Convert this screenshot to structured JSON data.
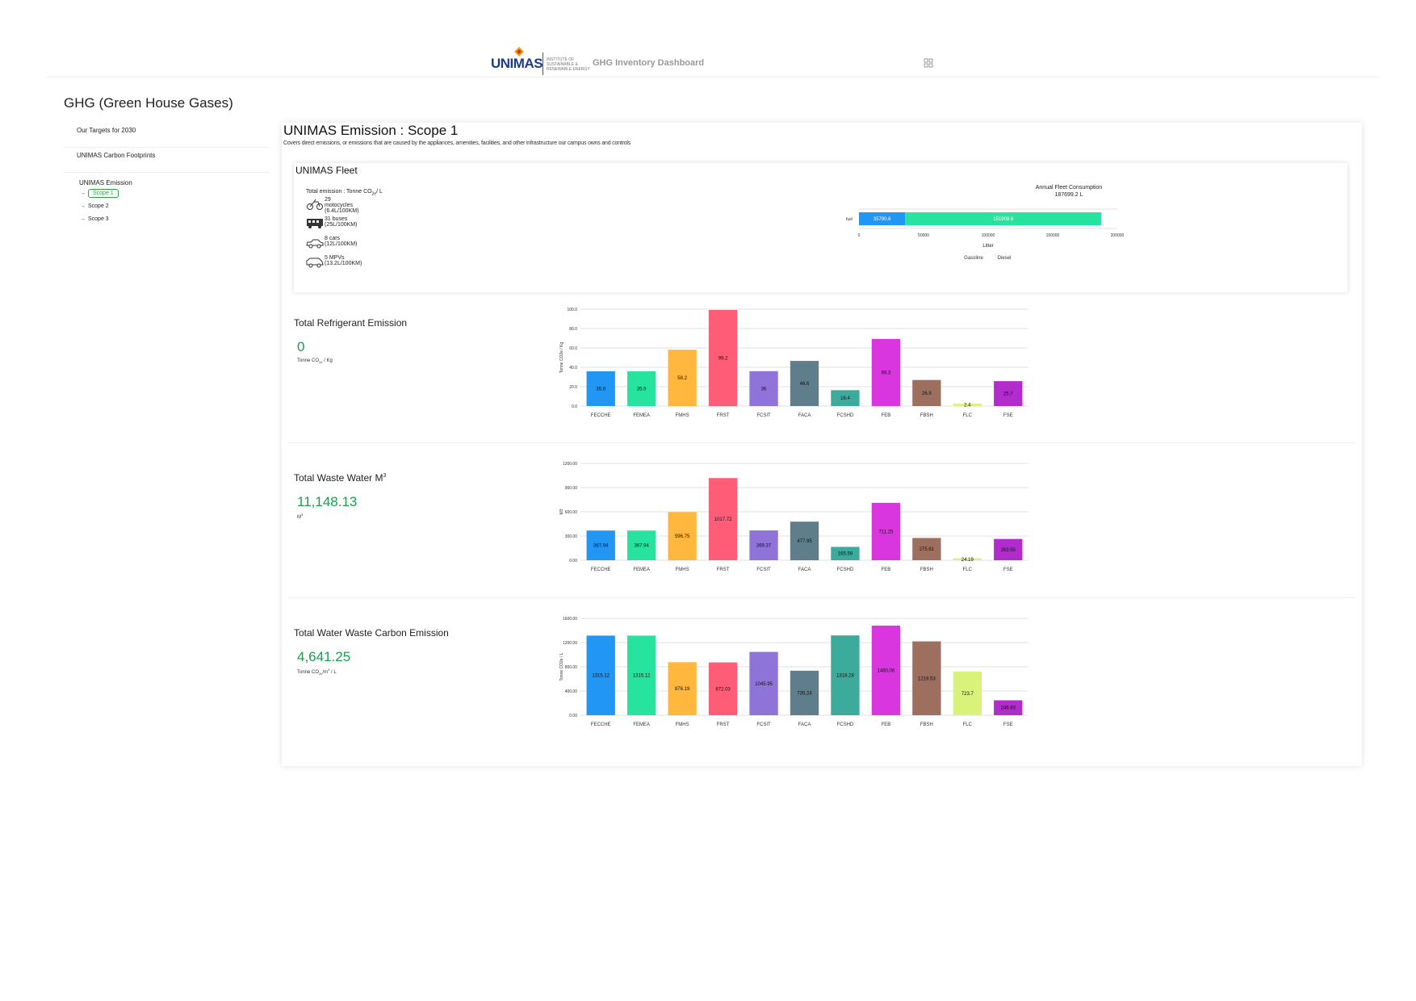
{
  "header": {
    "logo_text": "UNIMAS",
    "logo_subtitle_lines": [
      "INSTITUTE OF",
      "SUSTAINABLE &",
      "RENEWABLE ENERGY"
    ],
    "app_title": "GHG Inventory Dashboard"
  },
  "page": {
    "title": "GHG (Green House Gases)"
  },
  "sidebar": {
    "items": [
      {
        "label": "Our Targets for 2030"
      },
      {
        "label": "UNIMAS Carbon Footprints"
      },
      {
        "label": "UNIMAS Emission"
      }
    ],
    "scopes": [
      {
        "label": "Scope 1",
        "active": true
      },
      {
        "label": "Scope 2",
        "active": false
      },
      {
        "label": "Scope 3",
        "active": false
      }
    ]
  },
  "main": {
    "title": "UNIMAS Emission : Scope 1",
    "description": "Covers direct emissions, or emissions that are caused by the appliances, amenities, facilities, and other infrastructure our campus owns and controls"
  },
  "fleet": {
    "title": "UNIMAS Fleet",
    "total_label": "Total emission : Tonne CO",
    "total_sub": "2e",
    "total_suffix": "/ L",
    "vehicles": [
      {
        "icon": "motorcycle-icon",
        "label": "29 motocycles (6.4L/100KM)"
      },
      {
        "icon": "bus-icon",
        "label": "31 buses (25L/100KM)"
      },
      {
        "icon": "car-icon",
        "label": "8 cars (12L/100KM)"
      },
      {
        "icon": "mpv-icon",
        "label": "5 MPVs (13.2L/100KM)"
      }
    ],
    "consumption_title": "Annual Fleet Consumption",
    "consumption_value": "187699.2 L"
  },
  "refrigerant": {
    "title": "Total Refrigerant Emission",
    "value": "0",
    "unit_main": "Tonne CO",
    "unit_sub": "2e",
    "unit_suffix": " / Kg"
  },
  "wastewater": {
    "title": "Total Waste Water M",
    "title_sup": "3",
    "value": "11,148.13",
    "unit_main": "M",
    "unit_sup": "3"
  },
  "waterwaste": {
    "title": "Total Water Waste Carbon Emission",
    "value": "4,641.25",
    "unit_main": "Tonne CO",
    "unit_sub": "2e",
    "unit_mid": "/m",
    "unit_sup": "3",
    "unit_suffix": " / L"
  },
  "colors": [
    "#2196f3",
    "#26e3a0",
    "#ffb83d",
    "#ff5c77",
    "#8f73d9",
    "#607d8b",
    "#3dab9c",
    "#d936e0",
    "#9c6f5f",
    "#d8f27a",
    "#b22bcc"
  ],
  "chart_data": [
    {
      "id": "fleet",
      "type": "bar",
      "orientation": "horizontal",
      "stacked": true,
      "categories": [
        "fuel"
      ],
      "series": [
        {
          "name": "Gasoline",
          "values": [
            35790.6
          ],
          "color": "#2196f3"
        },
        {
          "name": "Diesel",
          "values": [
            151908.6
          ],
          "color": "#26e3a0"
        }
      ],
      "data_labels": [
        "35790.6",
        "151908.6"
      ],
      "xlabel": "Litter",
      "xlim": [
        0,
        200000
      ],
      "xticks": [
        "0",
        "50000",
        "100000",
        "150000",
        "200000"
      ],
      "legend": "bottom"
    },
    {
      "id": "refrigerant",
      "type": "bar",
      "categories": [
        "FECCHE",
        "FEMEA",
        "FMHS",
        "FRST",
        "FCSIT",
        "FACA",
        "FCSHD",
        "FEB",
        "FBSH",
        "FLC",
        "FSE"
      ],
      "values": [
        35.9,
        35.9,
        58.2,
        99.2,
        36,
        46.6,
        16.4,
        69.3,
        26.9,
        2.4,
        25.7
      ],
      "data_labels": [
        "35.9",
        "35.9",
        "58.2",
        "99.2",
        "36",
        "46.6",
        "16.4",
        "69.3",
        "26.9",
        "2.4",
        "25.7"
      ],
      "ylabel": "Tonne CO2e / Kg",
      "ylim": [
        0,
        100
      ],
      "yticks": [
        "0.0",
        "20.0",
        "40.0",
        "60.0",
        "80.0",
        "100.0"
      ],
      "grid": true
    },
    {
      "id": "wastewater",
      "type": "bar",
      "categories": [
        "FECCHE",
        "FEMEA",
        "FMHS",
        "FRST",
        "FCSIT",
        "FACA",
        "FCSHD",
        "FEB",
        "FBSH",
        "FLC",
        "FSE"
      ],
      "values": [
        367.94,
        367.94,
        596.75,
        1017.72,
        369.37,
        477.95,
        165.59,
        711.25,
        275.61,
        24.19,
        263.55
      ],
      "data_labels": [
        "367.94",
        "367.94",
        "596.75",
        "1017.72",
        "369.37",
        "477.95",
        "165.59",
        "711.25",
        "275.61",
        "24.19",
        "263.55"
      ],
      "ylabel": "M3",
      "ylim": [
        0,
        1200
      ],
      "yticks": [
        "0.00",
        "300.00",
        "600.00",
        "900.00",
        "1200.00"
      ],
      "grid": true
    },
    {
      "id": "waterwaste",
      "type": "bar",
      "categories": [
        "FECCHE",
        "FEMEA",
        "FMHS",
        "FRST",
        "FCSIT",
        "FACA",
        "FCSHD",
        "FEB",
        "FBSH",
        "FLC",
        "FSE"
      ],
      "values": [
        1315.12,
        1315.12,
        876.19,
        872.03,
        1045.95,
        735.24,
        1318.28,
        1480.06,
        1219.53,
        723.7,
        246.93
      ],
      "data_labels": [
        "1315.12",
        "1315.12",
        "876.19",
        "872.03",
        "1045.95",
        "735.24",
        "1318.28",
        "1480.06",
        "1219.53",
        "723.7",
        "246.93"
      ],
      "ylabel": "Tonne CO2e / L",
      "ylim": [
        0,
        1600
      ],
      "yticks": [
        "0.00",
        "400.00",
        "800.00",
        "1200.00",
        "1600.00"
      ],
      "grid": true
    }
  ]
}
